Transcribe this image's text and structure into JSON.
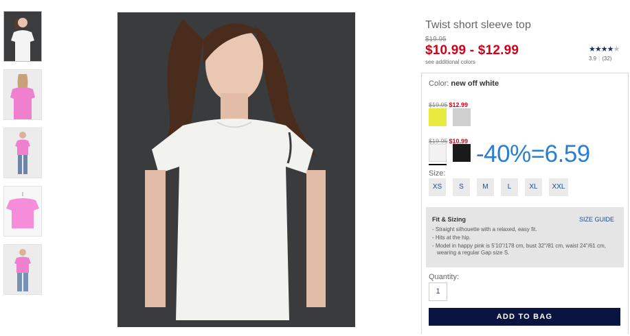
{
  "product": {
    "title": "Twist short sleeve top",
    "original_price": "$19.95",
    "sale_price": "$10.99 - $12.99",
    "see_colors": "see additional colors",
    "rating_stars": "★★★★",
    "rating_star_off": "★",
    "rating_value": "3.9",
    "rating_sep": "|",
    "review_count": "(32)"
  },
  "colors": {
    "label": "Color:",
    "selected": "new off white",
    "group1": {
      "old": "$19.95",
      "new": "$12.99",
      "swatches": [
        "#e9ea3f",
        "#cfcfcf"
      ]
    },
    "group2": {
      "old": "$19.95",
      "new": "$10.99",
      "swatches": [
        "#f2f2f2",
        "#1a1a1a"
      ]
    }
  },
  "annotation": "-40%=6.59",
  "sizes": {
    "label": "Size:",
    "options": [
      "XS",
      "S",
      "M",
      "L",
      "XL",
      "XXL"
    ]
  },
  "fit": {
    "title": "Fit & Sizing",
    "guide": "SIZE GUIDE",
    "items": [
      "Straight silhouette with a relaxed, easy fit.",
      "Hits at the hip.",
      "Model in happy pink is 5'10\"/178 cm, bust 32\"/81 cm, waist 24\"/61 cm, wearing a regular Gap size S."
    ]
  },
  "quantity": {
    "label": "Quantity:",
    "value": "1"
  },
  "add_to_bag": "ADD TO BAG",
  "thumbnails": [
    {
      "name": "thumb-white-model",
      "garment": "#f4f4f4"
    },
    {
      "name": "thumb-pink-back",
      "garment": "#ef7fcf"
    },
    {
      "name": "thumb-pink-full",
      "garment": "#ef7fcf"
    },
    {
      "name": "thumb-pink-flat",
      "garment": "#f58ddb"
    },
    {
      "name": "thumb-pink-jeans",
      "garment": "#ef7fcf"
    }
  ]
}
